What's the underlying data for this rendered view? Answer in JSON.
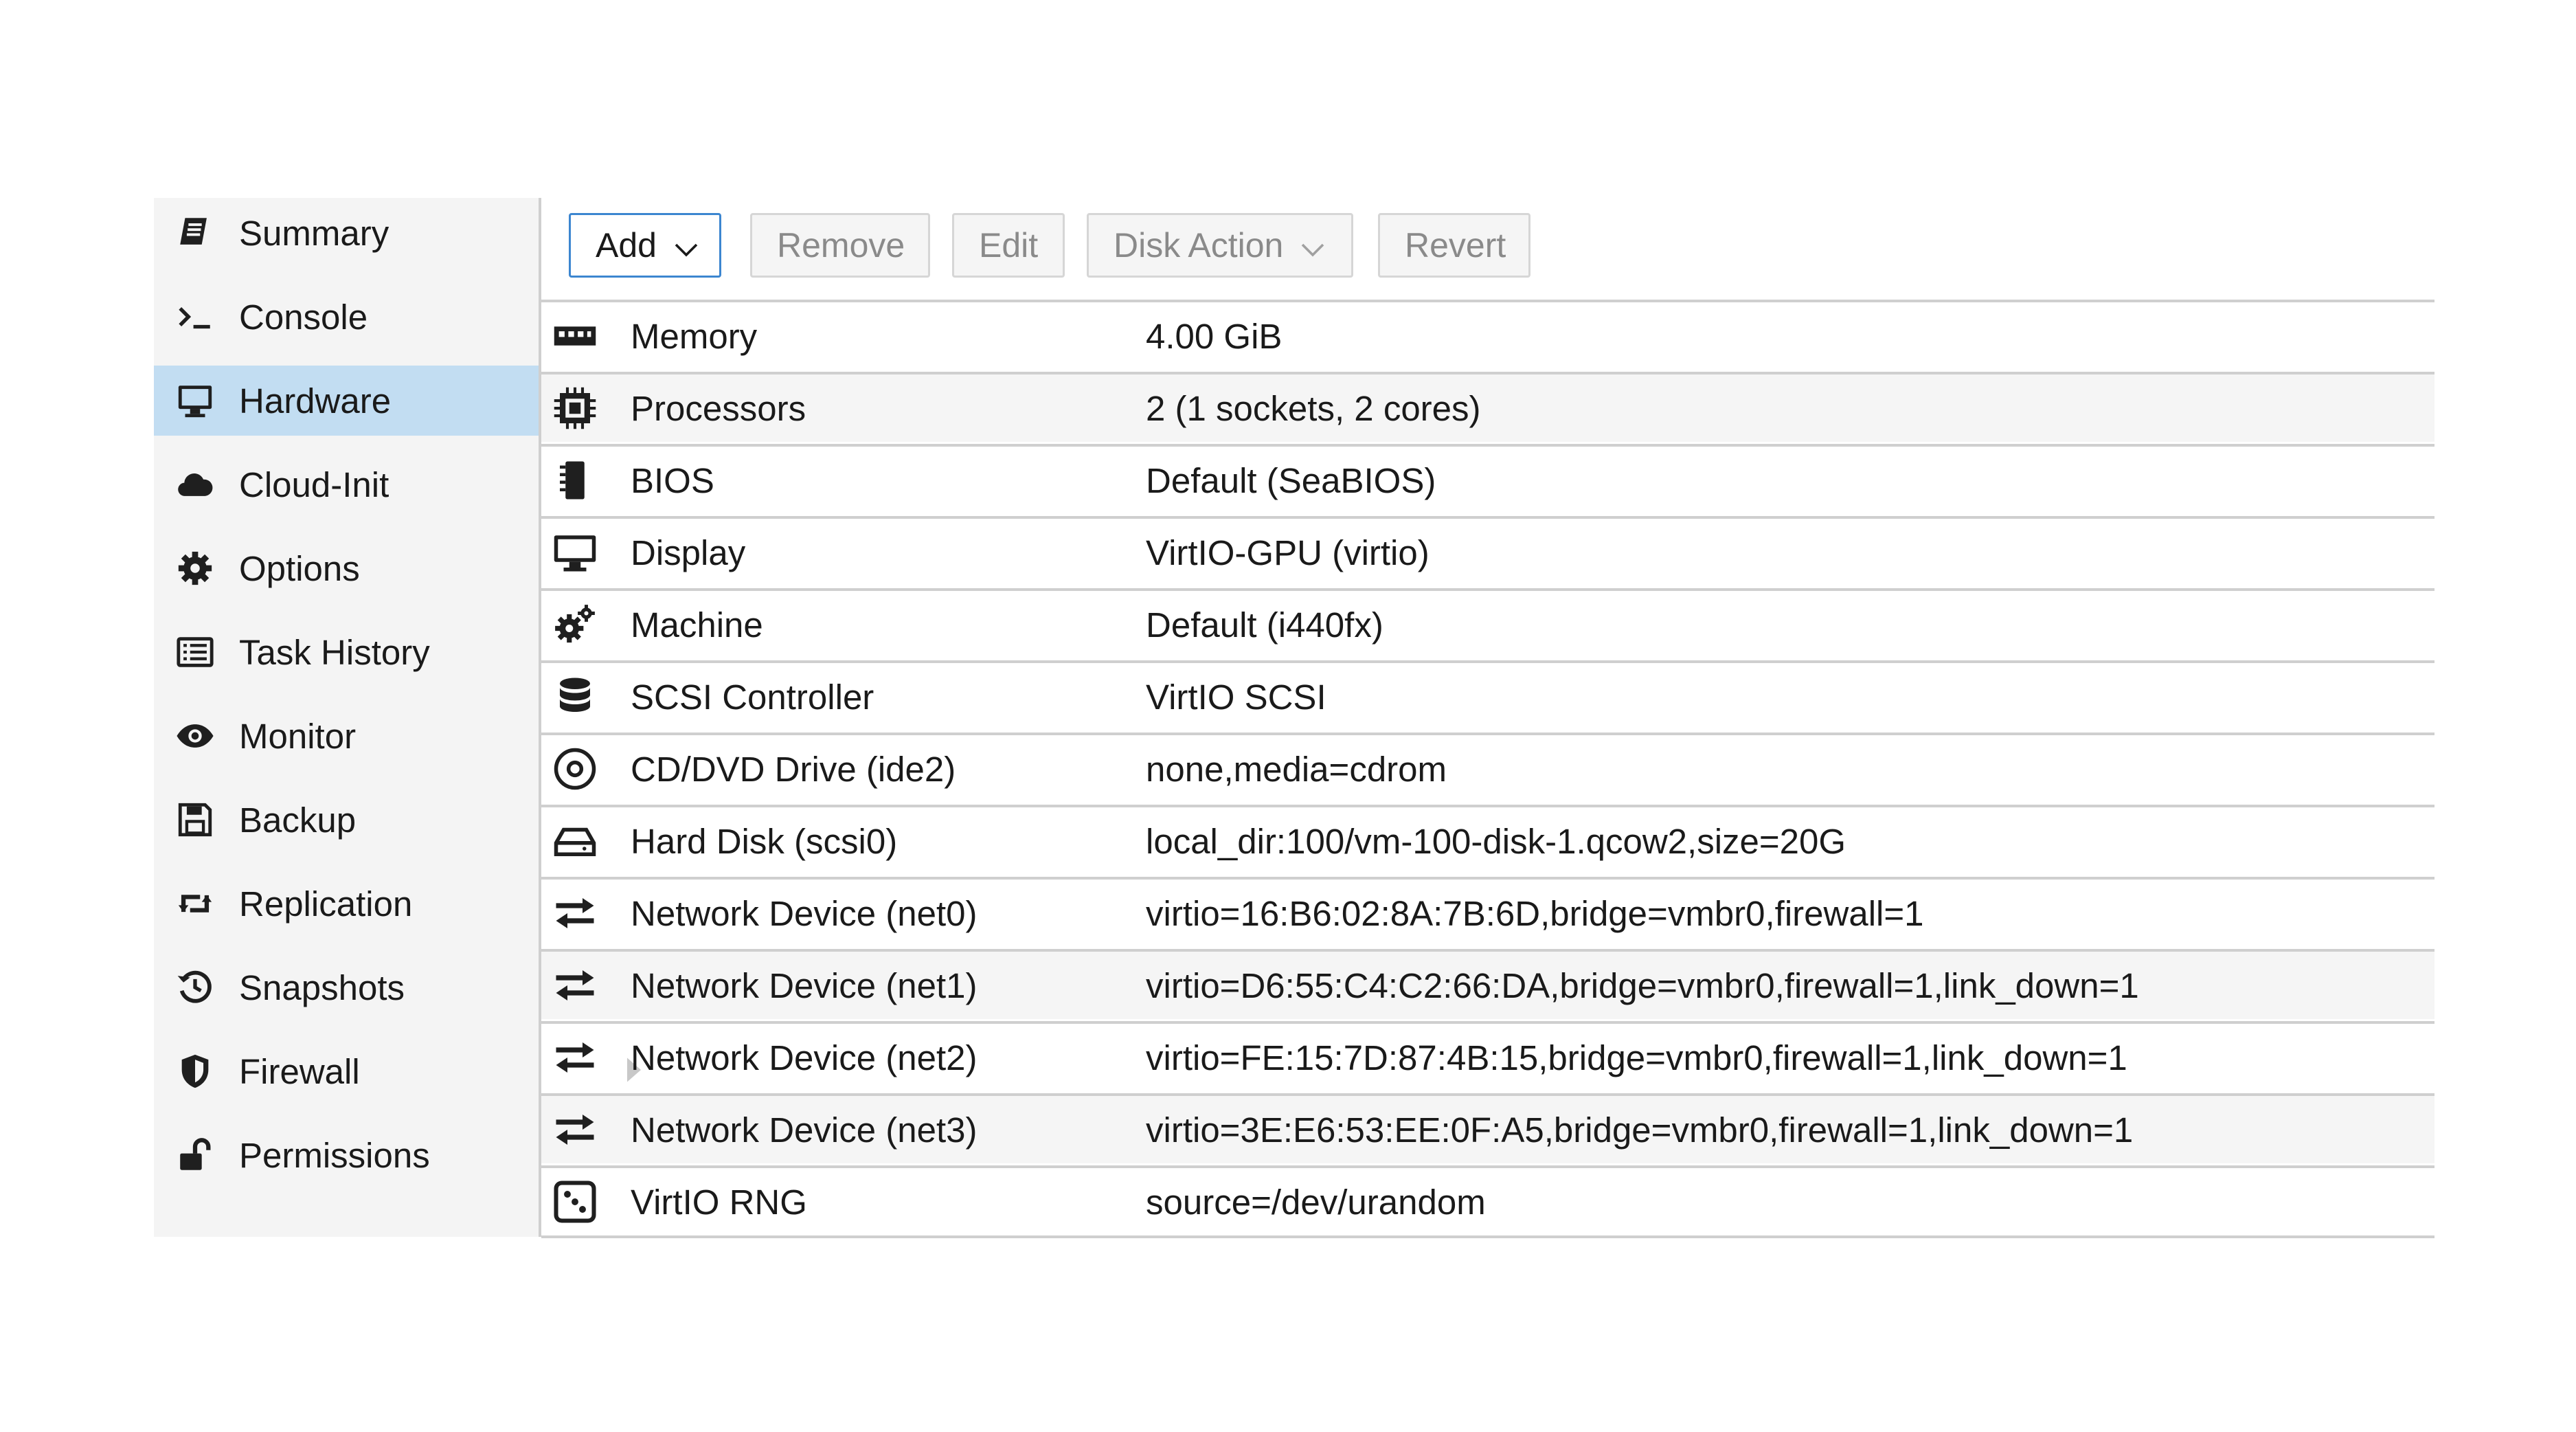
{
  "sidebar": {
    "items": [
      {
        "label": "Summary",
        "icon": "book-icon"
      },
      {
        "label": "Console",
        "icon": "terminal-icon"
      },
      {
        "label": "Hardware",
        "icon": "desktop-icon",
        "active": true
      },
      {
        "label": "Cloud-Init",
        "icon": "cloud-icon"
      },
      {
        "label": "Options",
        "icon": "gear-icon"
      },
      {
        "label": "Task History",
        "icon": "list-icon"
      },
      {
        "label": "Monitor",
        "icon": "eye-icon"
      },
      {
        "label": "Backup",
        "icon": "floppy-icon"
      },
      {
        "label": "Replication",
        "icon": "retweet-icon"
      },
      {
        "label": "Snapshots",
        "icon": "history-icon"
      },
      {
        "label": "Firewall",
        "icon": "shield-icon",
        "expandable": true
      },
      {
        "label": "Permissions",
        "icon": "unlock-icon"
      }
    ]
  },
  "toolbar": {
    "add": "Add",
    "remove": "Remove",
    "edit": "Edit",
    "disk_action": "Disk Action",
    "revert": "Revert"
  },
  "hardware": {
    "rows": [
      {
        "name": "Memory",
        "value": "4.00 GiB",
        "icon": "memory-icon"
      },
      {
        "name": "Processors",
        "value": "2 (1 sockets, 2 cores)",
        "icon": "cpu-icon"
      },
      {
        "name": "BIOS",
        "value": "Default (SeaBIOS)",
        "icon": "chip-icon"
      },
      {
        "name": "Display",
        "value": "VirtIO-GPU (virtio)",
        "icon": "desktop-icon"
      },
      {
        "name": "Machine",
        "value": "Default (i440fx)",
        "icon": "cogs-icon"
      },
      {
        "name": "SCSI Controller",
        "value": "VirtIO SCSI",
        "icon": "database-icon"
      },
      {
        "name": "CD/DVD Drive (ide2)",
        "value": "none,media=cdrom",
        "icon": "cdrom-icon"
      },
      {
        "name": "Hard Disk (scsi0)",
        "value": "local_dir:100/vm-100-disk-1.qcow2,size=20G",
        "icon": "hdd-icon"
      },
      {
        "name": "Network Device (net0)",
        "value": "virtio=16:B6:02:8A:7B:6D,bridge=vmbr0,firewall=1",
        "icon": "exchange-icon"
      },
      {
        "name": "Network Device (net1)",
        "value": "virtio=D6:55:C4:C2:66:DA,bridge=vmbr0,firewall=1,link_down=1",
        "icon": "exchange-icon"
      },
      {
        "name": "Network Device (net2)",
        "value": "virtio=FE:15:7D:87:4B:15,bridge=vmbr0,firewall=1,link_down=1",
        "icon": "exchange-icon"
      },
      {
        "name": "Network Device (net3)",
        "value": "virtio=3E:E6:53:EE:0F:A5,bridge=vmbr0,firewall=1,link_down=1",
        "icon": "exchange-icon"
      },
      {
        "name": "VirtIO RNG",
        "value": "source=/dev/urandom",
        "icon": "dice-icon"
      }
    ]
  },
  "colors": {
    "active": "#c2ddf2",
    "sidebar_bg": "#f4f4f4",
    "accent": "#3c86d0"
  }
}
